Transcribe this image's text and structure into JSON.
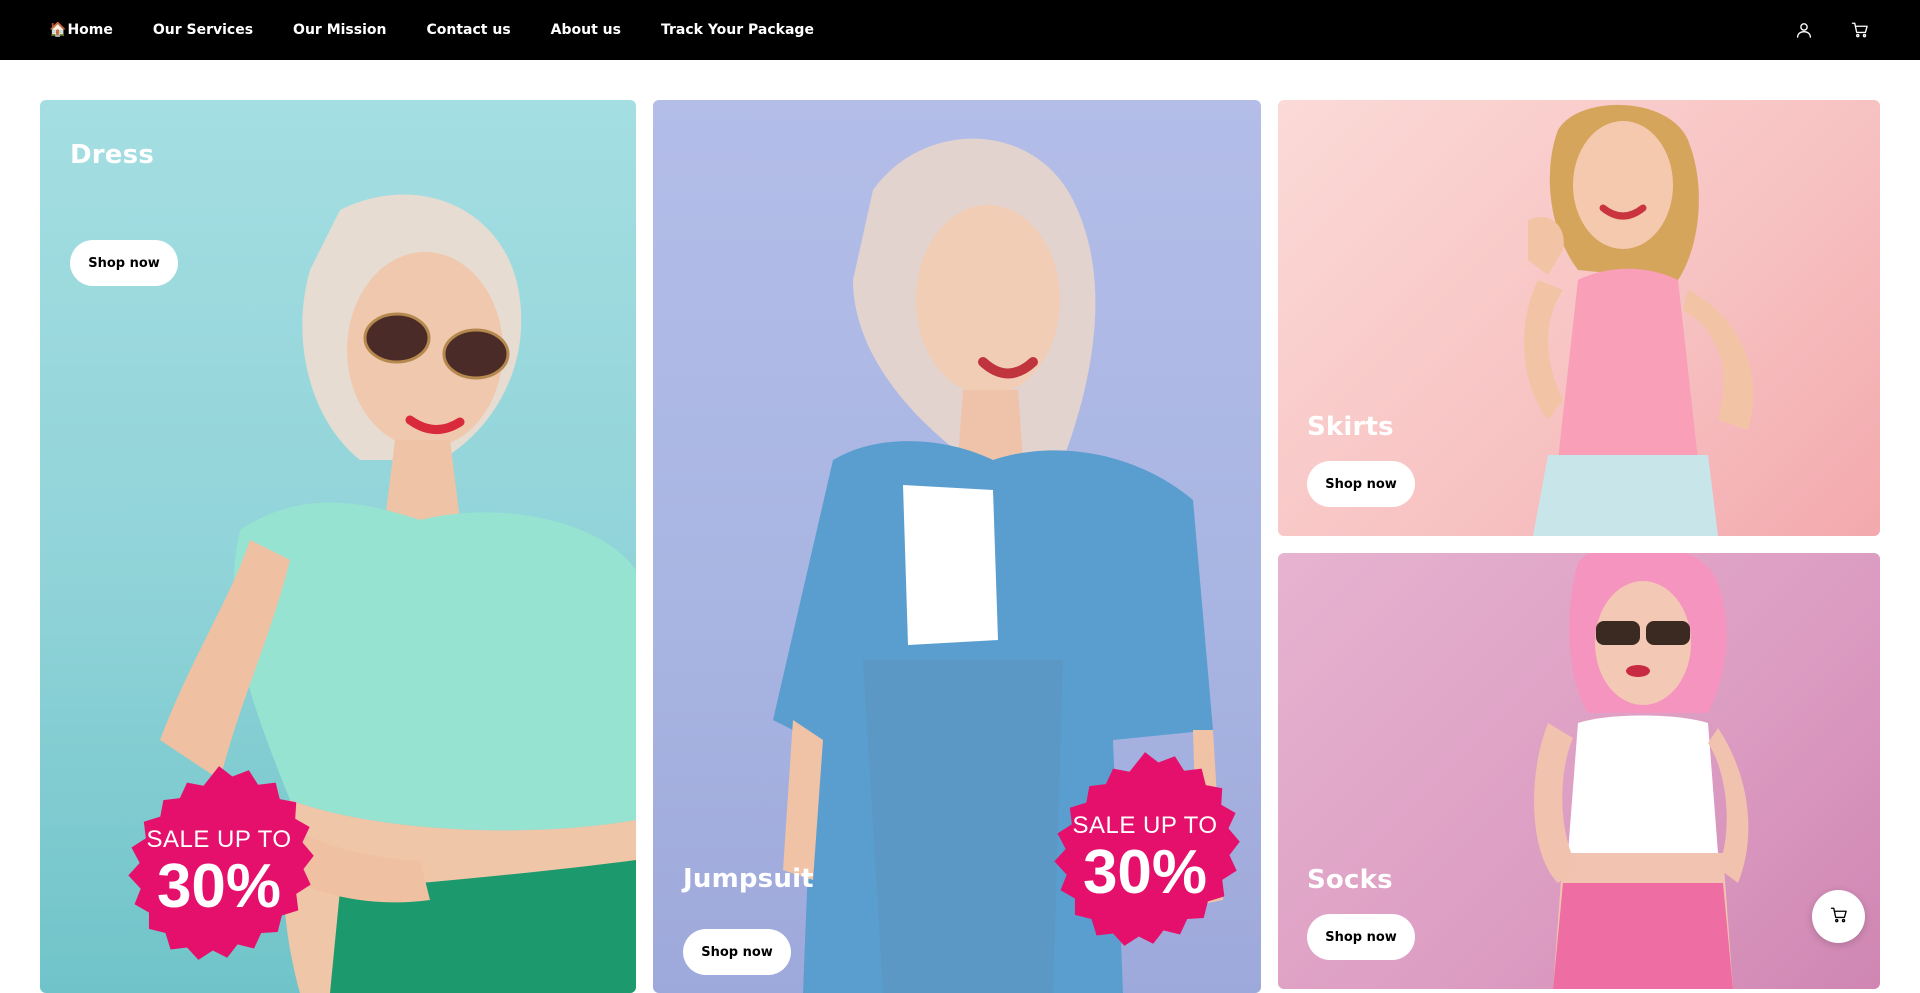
{
  "nav": {
    "home_glyph": "🏠",
    "links": [
      "Home",
      "Our Services",
      "Our Mission",
      "Contact us",
      "About us",
      "Track Your Package"
    ],
    "icons": [
      "user-icon",
      "cart-icon"
    ]
  },
  "cards": {
    "dress": {
      "title": "Dress",
      "button": "Shop now",
      "badge_top": "SALE UP TO",
      "badge_value": "30%"
    },
    "jumpsuit": {
      "title": "Jumpsuit",
      "button": "Shop now",
      "badge_top": "SALE UP TO",
      "badge_value": "30%"
    },
    "skirts": {
      "title": "Skirts",
      "button": "Shop now"
    },
    "socks": {
      "title": "Socks",
      "button": "Shop now"
    }
  },
  "floating_cart": {
    "icon": "cart-icon"
  },
  "colors": {
    "navbar": "#000000",
    "dress_bg": "#8fd3d8",
    "jumpsuit_bg": "#a9b5e2",
    "skirts_bg": "#f7c1c1",
    "socks_bg": "#dc9cc2",
    "badge": "#e5106b"
  }
}
